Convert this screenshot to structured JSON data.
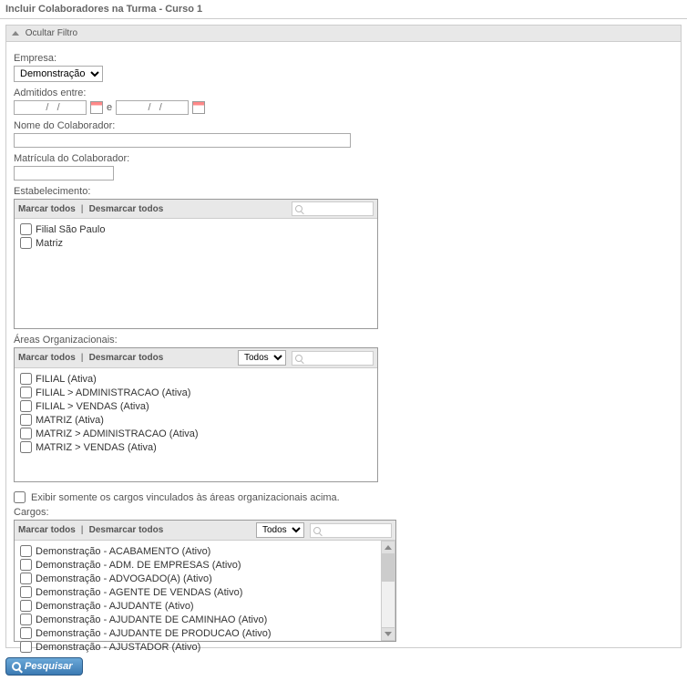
{
  "page_title": "Incluir Colaboradores na Turma - Curso 1",
  "filter": {
    "toggle_label": "Ocultar Filtro",
    "empresa_label": "Empresa:",
    "empresa_value": "Demonstração",
    "admitidos_label": "Admitidos entre:",
    "date_placeholder": "  /   /",
    "date_sep": "e",
    "nome_label": "Nome do Colaborador:",
    "matricula_label": "Matrícula do Colaborador:",
    "estab_label": "Estabelecimento:",
    "areas_label": "Áreas Organizacionais:",
    "cargos_label": "Cargos:",
    "cargos_vinculados_label": "Exibir somente os cargos vinculados às áreas organizacionais acima.",
    "marcar_todos": "Marcar todos",
    "desmarcar_todos": "Desmarcar todos",
    "todos_option": "Todos",
    "estab_items": [
      "Filial São Paulo",
      "Matriz"
    ],
    "areas_items": [
      "FILIAL (Ativa)",
      "FILIAL > ADMINISTRACAO (Ativa)",
      "FILIAL > VENDAS (Ativa)",
      "MATRIZ (Ativa)",
      "MATRIZ > ADMINISTRACAO (Ativa)",
      "MATRIZ > VENDAS (Ativa)"
    ],
    "cargos_items": [
      "Demonstração - ACABAMENTO (Ativo)",
      "Demonstração - ADM. DE EMPRESAS (Ativo)",
      "Demonstração - ADVOGADO(A) (Ativo)",
      "Demonstração - AGENTE DE VENDAS (Ativo)",
      "Demonstração - AJUDANTE (Ativo)",
      "Demonstração - AJUDANTE DE CAMINHAO (Ativo)",
      "Demonstração - AJUDANTE DE PRODUCAO (Ativo)",
      "Demonstração - AJUSTADOR (Ativo)"
    ]
  },
  "search_button": "Pesquisar"
}
